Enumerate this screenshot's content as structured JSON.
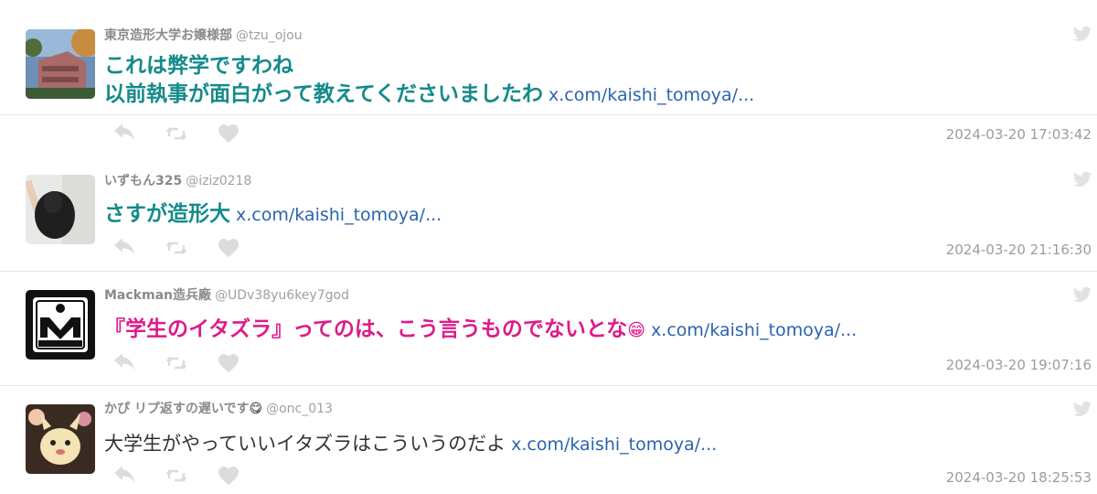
{
  "tweets": [
    {
      "name": "東京造形大学お嬢様部",
      "handle": "@tzu_ojou",
      "lines": [
        "これは弊学ですわね",
        "以前執事が面白がって教えてくださいましたわ"
      ],
      "link": "x.com/kaishi_tomoya/...",
      "timestamp": "2024-03-20 17:03:42",
      "style": "teal"
    },
    {
      "name": "いずもん325",
      "handle": "@iziz0218",
      "lines": [
        "さすが造形大"
      ],
      "link": "x.com/kaishi_tomoya/...",
      "timestamp": "2024-03-20 21:16:30",
      "style": "teal"
    },
    {
      "name": "Mackman造兵廠",
      "handle": "@UDv38yu6key7god",
      "lines": [
        "『学生のイタズラ』ってのは、こう言うものでないとな"
      ],
      "emoji": "😁",
      "link": "x.com/kaishi_tomoya/...",
      "timestamp": "2024-03-20 19:07:16",
      "style": "pink"
    },
    {
      "name": "かぴ リプ返すの遅いです",
      "name_emoji": "😋",
      "handle": "@onc_013",
      "lines": [
        "大学生がやっていいイタズラはこういうのだよ"
      ],
      "link": "x.com/kaishi_tomoya/...",
      "timestamp": "2024-03-20 18:25:53",
      "style": "plain"
    }
  ],
  "icons": {
    "reply": "reply-icon",
    "retweet": "retweet-icon",
    "like": "heart-icon",
    "platform": "twitter-bird-icon"
  },
  "colors": {
    "teal_text": "#158a8a",
    "pink_text": "#de1a8a",
    "link": "#2a64ae",
    "meta": "#9c9c9c",
    "icon": "#dcdcdc"
  }
}
